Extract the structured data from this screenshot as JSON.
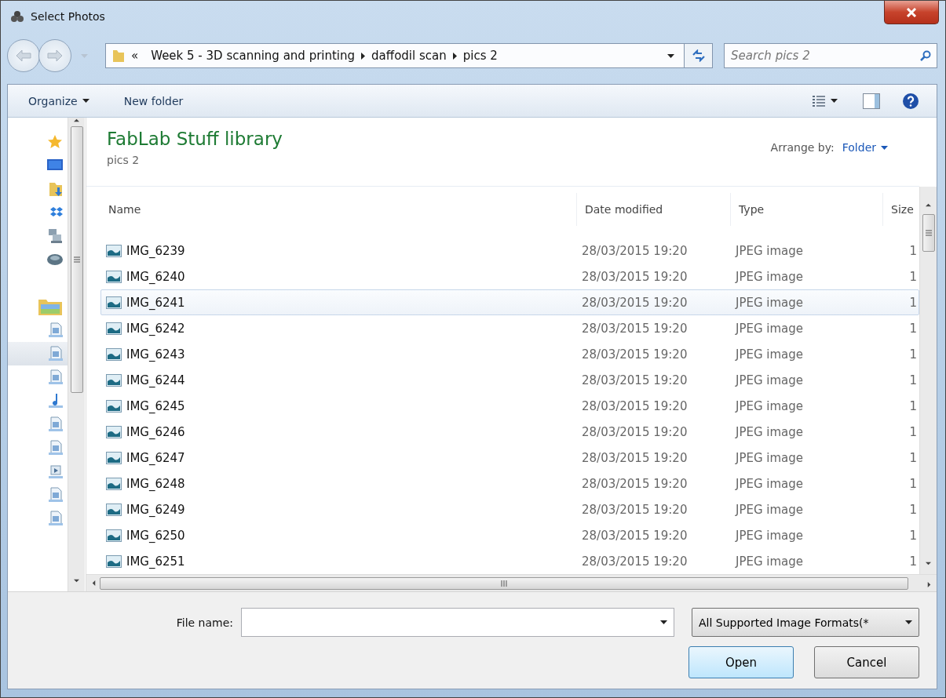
{
  "window": {
    "title": "Select Photos"
  },
  "address": {
    "overflow": "«",
    "crumbs": [
      "Week 5 - 3D scanning and printing",
      "daffodil scan",
      "pics 2"
    ]
  },
  "search": {
    "placeholder": "Search pics 2"
  },
  "toolbar": {
    "buttons": [
      {
        "label": "Organize",
        "menu": true
      },
      {
        "label": "New folder",
        "menu": false
      }
    ]
  },
  "sidebar": {
    "items": [
      {
        "kind": "star",
        "selected": false
      },
      {
        "kind": "desktop",
        "selected": false
      },
      {
        "kind": "downloads",
        "selected": false
      },
      {
        "kind": "dropbox",
        "selected": false
      },
      {
        "kind": "network",
        "selected": false
      },
      {
        "kind": "disk",
        "selected": false
      },
      {
        "kind": "gap"
      },
      {
        "kind": "library",
        "selected": false
      },
      {
        "kind": "document",
        "selected": false
      },
      {
        "kind": "document",
        "selected": true
      },
      {
        "kind": "document",
        "selected": false
      },
      {
        "kind": "music",
        "selected": false
      },
      {
        "kind": "document",
        "selected": false
      },
      {
        "kind": "document",
        "selected": false
      },
      {
        "kind": "video",
        "selected": false
      },
      {
        "kind": "document",
        "selected": false
      },
      {
        "kind": "document",
        "selected": false
      }
    ]
  },
  "library": {
    "title": "FabLab Stuff library",
    "subtitle": "pics 2",
    "arrange_label": "Arrange by:",
    "arrange_value": "Folder"
  },
  "table": {
    "columns": [
      "Name",
      "Date modified",
      "Type",
      "Size"
    ],
    "rows": [
      {
        "name": "IMG_6239",
        "date": "28/03/2015 19:20",
        "type": "JPEG image",
        "size": "1",
        "selected": false
      },
      {
        "name": "IMG_6240",
        "date": "28/03/2015 19:20",
        "type": "JPEG image",
        "size": "1",
        "selected": false
      },
      {
        "name": "IMG_6241",
        "date": "28/03/2015 19:20",
        "type": "JPEG image",
        "size": "1",
        "selected": true
      },
      {
        "name": "IMG_6242",
        "date": "28/03/2015 19:20",
        "type": "JPEG image",
        "size": "1",
        "selected": false
      },
      {
        "name": "IMG_6243",
        "date": "28/03/2015 19:20",
        "type": "JPEG image",
        "size": "1",
        "selected": false
      },
      {
        "name": "IMG_6244",
        "date": "28/03/2015 19:20",
        "type": "JPEG image",
        "size": "1",
        "selected": false
      },
      {
        "name": "IMG_6245",
        "date": "28/03/2015 19:20",
        "type": "JPEG image",
        "size": "1",
        "selected": false
      },
      {
        "name": "IMG_6246",
        "date": "28/03/2015 19:20",
        "type": "JPEG image",
        "size": "1",
        "selected": false
      },
      {
        "name": "IMG_6247",
        "date": "28/03/2015 19:20",
        "type": "JPEG image",
        "size": "1",
        "selected": false
      },
      {
        "name": "IMG_6248",
        "date": "28/03/2015 19:20",
        "type": "JPEG image",
        "size": "1",
        "selected": false
      },
      {
        "name": "IMG_6249",
        "date": "28/03/2015 19:20",
        "type": "JPEG image",
        "size": "1",
        "selected": false
      },
      {
        "name": "IMG_6250",
        "date": "28/03/2015 19:20",
        "type": "JPEG image",
        "size": "1",
        "selected": false
      },
      {
        "name": "IMG_6251",
        "date": "28/03/2015 19:20",
        "type": "JPEG image",
        "size": "1",
        "selected": false
      }
    ]
  },
  "footer": {
    "file_name_label": "File name:",
    "file_type": "All Supported Image Formats(*",
    "buttons": [
      "Open",
      "Cancel"
    ]
  }
}
